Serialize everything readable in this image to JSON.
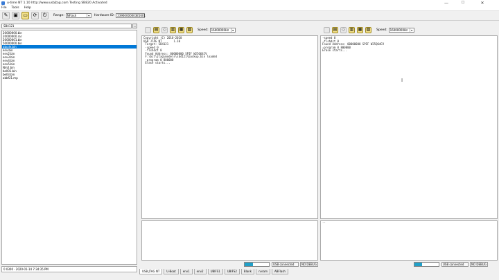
{
  "window": {
    "title": "u-time NT 1.10 http://www.usbjtag.com   Testing SB820 Activated",
    "controls": [
      "—",
      "☐",
      "✕"
    ]
  },
  "menu": [
    "File",
    "Tools",
    "Help"
  ],
  "toolbar": {
    "range_label": "Range:",
    "range_value": "NFlash",
    "hardware_label": "Hardware ID:",
    "hardware_value": "23960000003E5601"
  },
  "left": {
    "filter_value": "SB4121",
    "filter_button": "...",
    "files": [
      "20000000.bin",
      "20000000.rar",
      "20000001.bin",
      "50000000.bin",
      "abcde.bin",
      "env.bin",
      "env2.bin",
      "env3.bin",
      "env4.bin",
      "env5.bin",
      "Nm2.bin",
      "bell01.bin",
      "bell3.bin",
      "abbf21.mp"
    ],
    "selected_index": 4,
    "status": "0 0300 · 2020-01-14 7:34:35 PM"
  },
  "pane1": {
    "speed_label": "Speed:",
    "speed_value": "16000000Hz",
    "console": "Copyright (C) 2010-2020\nUSB JTAG NT       1.10\n Target: SB4121\n -speed 0\n -flshdct 0\n Found Address: 00000000 SPIF W25Q64CV\n F:\\bct\\jtag\\models\\sb4121\\backup.bin loaded\n -program 0 800000\n Erase starts..."
  },
  "pane2": {
    "speed_label": "Speed:",
    "speed_value": "16000000Hz",
    "console": "-speed 0\n-flshdct 0\nFound Address: 00000000 SPIF W25Q64CV\n-program 0 800000\nErase starts...",
    "bottom_text": "--"
  },
  "status": {
    "progress1": 0.35,
    "usb1": "USB connected",
    "debug1": "NO DEBUG",
    "progress2": 0.3,
    "usb2": "USB connected",
    "debug2": "NO DEBUG"
  },
  "tabs": [
    "USB JTAG NT",
    "U-Boot",
    "env1",
    "env2",
    "UBIFS1",
    "UBIFS2",
    "Blank",
    "nvram",
    "ABFlash"
  ],
  "active_tab": 0,
  "icons": [
    "pencil-icon",
    "save-icon",
    "folder-icon",
    "refresh-icon",
    "power-icon"
  ]
}
